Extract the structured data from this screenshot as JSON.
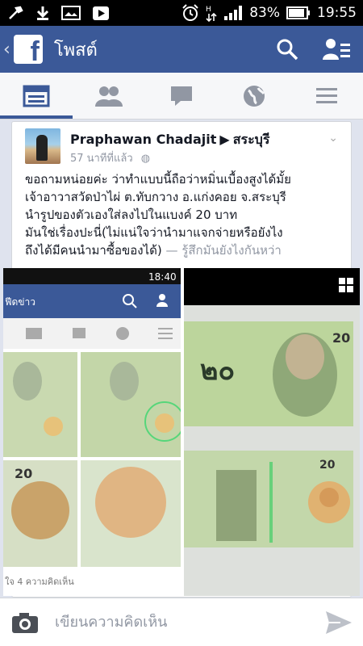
{
  "status_bar": {
    "battery": "83%",
    "time": "19:55"
  },
  "app_bar": {
    "title": "โพสต์"
  },
  "post": {
    "author": "Praphawan Chadajit",
    "location": "สระบุรี",
    "timestamp": "57 นาทีที่แล้ว",
    "lines": [
      "ขอถามหน่อยค่ะ ว่าทำแบบนี้ถือว่าหมิ่นเบื้องสูงได้มั้ย",
      "เจ้าอาวาสวัดป่าไผ่ ต.ทับกวาง อ.แก่งคอย จ.สระบุรี",
      "นำรูปของตัวเองใส่ลงไปในแบงค์ 20 บาท",
      "มันใช่เรื่องปะนี่(ไม่แน่ใจว่านำมาแจกจ่ายหรือยังไง"
    ],
    "last_line": "ถึงได้มีคนนำมาซื้อของได้)",
    "feeling": " — รู้สึกมันยังไงกันหว่า"
  },
  "inner_screenshot": {
    "time": "18:40",
    "header": "ฟีดข่าว",
    "footer": "ใจ 4 ความคิดเห็น"
  },
  "banknote": {
    "denomination": "20"
  },
  "composer": {
    "placeholder": "เขียนความคิดเห็น"
  },
  "colors": {
    "brand": "#3b5998",
    "link": "#9197a3"
  }
}
